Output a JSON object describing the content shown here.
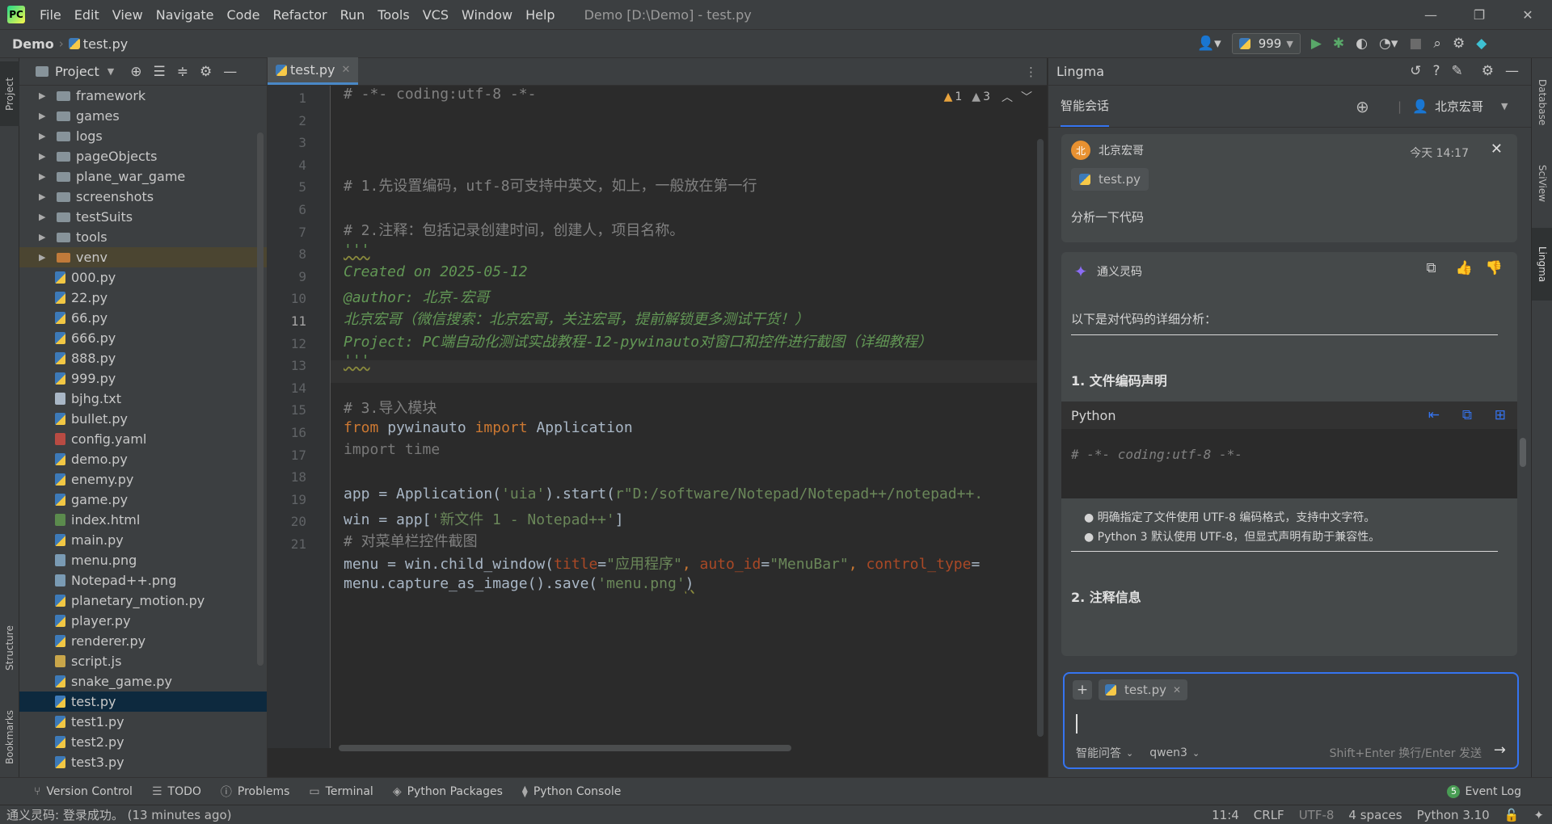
{
  "titlebar": {
    "menus": [
      "File",
      "Edit",
      "View",
      "Navigate",
      "Code",
      "Refactor",
      "Run",
      "Tools",
      "VCS",
      "Window",
      "Help"
    ],
    "title": "Demo [D:\\Demo] - test.py"
  },
  "navbar": {
    "project": "Demo",
    "file": "test.py",
    "run_config": "999"
  },
  "left_strip": {
    "project": "Project",
    "structure": "Structure",
    "bookmarks": "Bookmarks"
  },
  "project_panel": {
    "title": "Project",
    "items": [
      {
        "name": "framework",
        "type": "folder"
      },
      {
        "name": "games",
        "type": "folder"
      },
      {
        "name": "logs",
        "type": "folder"
      },
      {
        "name": "pageObjects",
        "type": "folder"
      },
      {
        "name": "plane_war_game",
        "type": "folder"
      },
      {
        "name": "screenshots",
        "type": "folder"
      },
      {
        "name": "testSuits",
        "type": "folder"
      },
      {
        "name": "tools",
        "type": "folder"
      },
      {
        "name": "venv",
        "type": "venv"
      },
      {
        "name": "000.py",
        "type": "py"
      },
      {
        "name": "22.py",
        "type": "py"
      },
      {
        "name": "66.py",
        "type": "py"
      },
      {
        "name": "666.py",
        "type": "py"
      },
      {
        "name": "888.py",
        "type": "py"
      },
      {
        "name": "999.py",
        "type": "py"
      },
      {
        "name": "bjhg.txt",
        "type": "txt"
      },
      {
        "name": "bullet.py",
        "type": "py"
      },
      {
        "name": "config.yaml",
        "type": "yaml"
      },
      {
        "name": "demo.py",
        "type": "py"
      },
      {
        "name": "enemy.py",
        "type": "py"
      },
      {
        "name": "game.py",
        "type": "py"
      },
      {
        "name": "index.html",
        "type": "html"
      },
      {
        "name": "main.py",
        "type": "py"
      },
      {
        "name": "menu.png",
        "type": "png"
      },
      {
        "name": "Notepad++.png",
        "type": "png"
      },
      {
        "name": "planetary_motion.py",
        "type": "py"
      },
      {
        "name": "player.py",
        "type": "py"
      },
      {
        "name": "renderer.py",
        "type": "py"
      },
      {
        "name": "script.js",
        "type": "js"
      },
      {
        "name": "snake_game.py",
        "type": "py"
      },
      {
        "name": "test.py",
        "type": "py",
        "selected": true
      },
      {
        "name": "test1.py",
        "type": "py"
      },
      {
        "name": "test2.py",
        "type": "py"
      },
      {
        "name": "test3.py",
        "type": "py"
      }
    ]
  },
  "editor": {
    "tab": "test.py",
    "warnings": "1",
    "weak_warnings": "3",
    "lines": [
      "1",
      "2",
      "3",
      "4",
      "5",
      "6",
      "7",
      "8",
      "9",
      "10",
      "11",
      "12",
      "13",
      "14",
      "15",
      "16",
      "17",
      "18",
      "19",
      "20",
      "21"
    ],
    "code": {
      "l1": "# -*- coding:utf-8 -*-",
      "l3": "# 1.先设置编码，utf-8可支持中英文，如上，一般放在第一行",
      "l5": "# 2.注释：包括记录创建时间，创建人，项目名称。",
      "l6": "'''",
      "l7": "Created on 2025-05-12",
      "l8": "@author: 北京-宏哥",
      "l9": "北京宏哥（微信搜索：北京宏哥，关注宏哥，提前解锁更多测试干货！）",
      "l10": "Project: PC端自动化测试实战教程-12-pywinauto对窗口和控件进行截图（详细教程）",
      "l11": "'''",
      "l13": "# 3.导入模块",
      "l14_kw1": "from",
      "l14_mid": " pywinauto ",
      "l14_kw2": "import",
      "l14_end": " Application",
      "l15": "import time",
      "l17_a": "app = Application(",
      "l17_s1": "'uia'",
      "l17_b": ").start(",
      "l17_s2": "r\"D:/software/Notepad/Notepad++/notepad++.",
      "l18_a": "win = app[",
      "l18_s": "'新文件 1 - Notepad++'",
      "l18_b": "]",
      "l19": "# 对菜单栏控件截图",
      "l20_a": "menu = win.child_window(",
      "l20_p1": "title",
      "l20_eq1": "=",
      "l20_s1": "\"应用程序\"",
      "l20_c1": ", ",
      "l20_p2": "auto_id",
      "l20_eq2": "=",
      "l20_s2": "\"MenuBar\"",
      "l20_c2": ", ",
      "l20_p3": "control_type",
      "l20_eq3": "=",
      "l21_a": "menu.capture_as_image().save(",
      "l21_s": "'menu.png'",
      "l21_b": ")"
    }
  },
  "lingma": {
    "title": "Lingma",
    "tab": "智能会话",
    "user": "北京宏哥",
    "user_avatar": "北",
    "time": "今天 14:17",
    "attached_file": "test.py",
    "question": "分析一下代码",
    "assistant": "通义灵码",
    "intro": "以下是对代码的详细分析：",
    "section1": "1. 文件编码声明",
    "code_lang": "Python",
    "code_line": "# -*- coding:utf-8 -*-",
    "bullets": [
      "明确指定了文件使用 UTF-8 编码格式，支持中文字符。",
      "Python 3 默认使用 UTF-8，但显式声明有助于兼容性。"
    ],
    "section2": "2. 注释信息",
    "input": {
      "file_chip": "test.py",
      "mode": "智能问答",
      "model": "qwen3",
      "hint": "Shift+Enter 换行/Enter 发送"
    }
  },
  "right_strip": {
    "database": "Database",
    "sciview": "SciView",
    "lingma": "Lingma"
  },
  "bottombar": {
    "tools": [
      "Version Control",
      "TODO",
      "Problems",
      "Terminal",
      "Python Packages",
      "Python Console"
    ],
    "event_log_count": "5",
    "event_log": "Event Log"
  },
  "statusbar": {
    "message": "通义灵码: 登录成功。 (13 minutes ago)",
    "position": "11:4",
    "line_sep": "CRLF",
    "encoding": "UTF-8",
    "indent": "4 spaces",
    "interpreter": "Python 3.10"
  },
  "colors": {
    "accent": "#3574f0",
    "selection": "#0d293e",
    "run_green": "#59a869"
  }
}
